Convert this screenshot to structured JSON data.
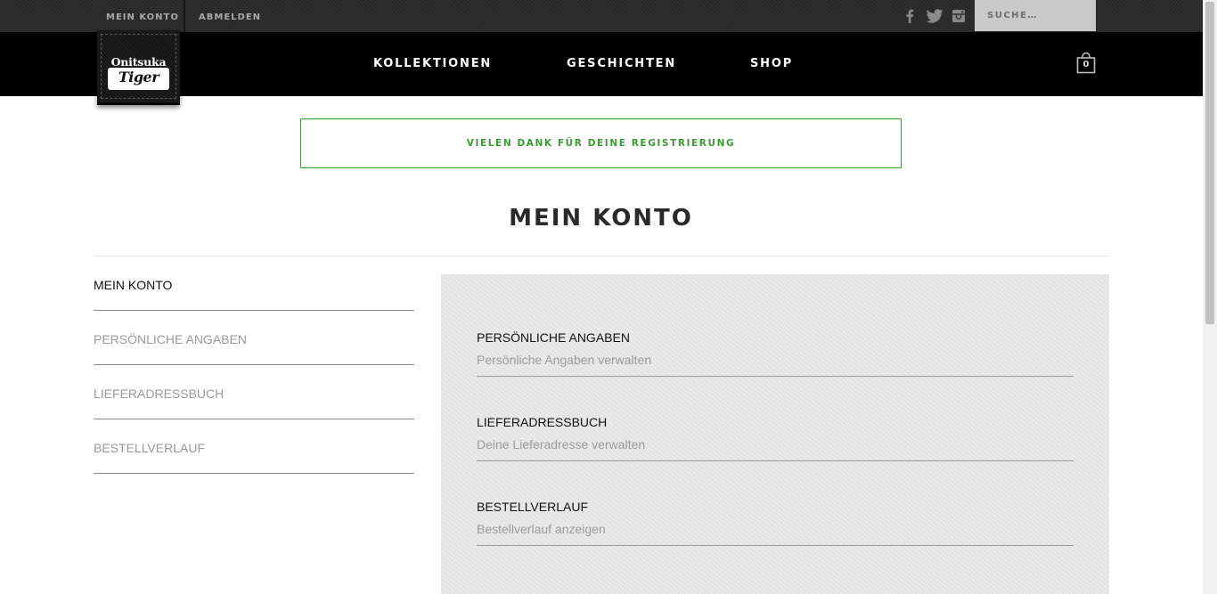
{
  "topbar": {
    "account_label": "MEIN KONTO",
    "logout_label": "ABMELDEN",
    "social": [
      "facebook-icon",
      "twitter-icon",
      "instagram-icon"
    ],
    "search_placeholder": "SUCHE…"
  },
  "logo": {
    "line1": "Onitsuka",
    "line2": "Tiger"
  },
  "nav": {
    "items": [
      "KOLLEKTIONEN",
      "GESCHICHTEN",
      "SHOP"
    ],
    "cart_count": "0"
  },
  "notice": {
    "text": "VIELEN DANK FÜR DEINE REGISTRIERUNG",
    "color": "#3a9b34"
  },
  "page_title": "MEIN KONTO",
  "sidebar": {
    "items": [
      {
        "label": "MEIN KONTO",
        "active": true
      },
      {
        "label": "PERSÖNLICHE ANGABEN",
        "active": false
      },
      {
        "label": "LIEFERADRESSBUCH",
        "active": false
      },
      {
        "label": "BESTELLVERLAUF",
        "active": false
      }
    ]
  },
  "cards": [
    {
      "title": "PERSÖNLICHE ANGABEN",
      "desc": "Persönliche Angaben verwalten"
    },
    {
      "title": "LIEFERADRESSBUCH",
      "desc": "Deine Lieferadresse verwalten"
    },
    {
      "title": "BESTELLVERLAUF",
      "desc": "Bestellverlauf anzeigen"
    }
  ]
}
